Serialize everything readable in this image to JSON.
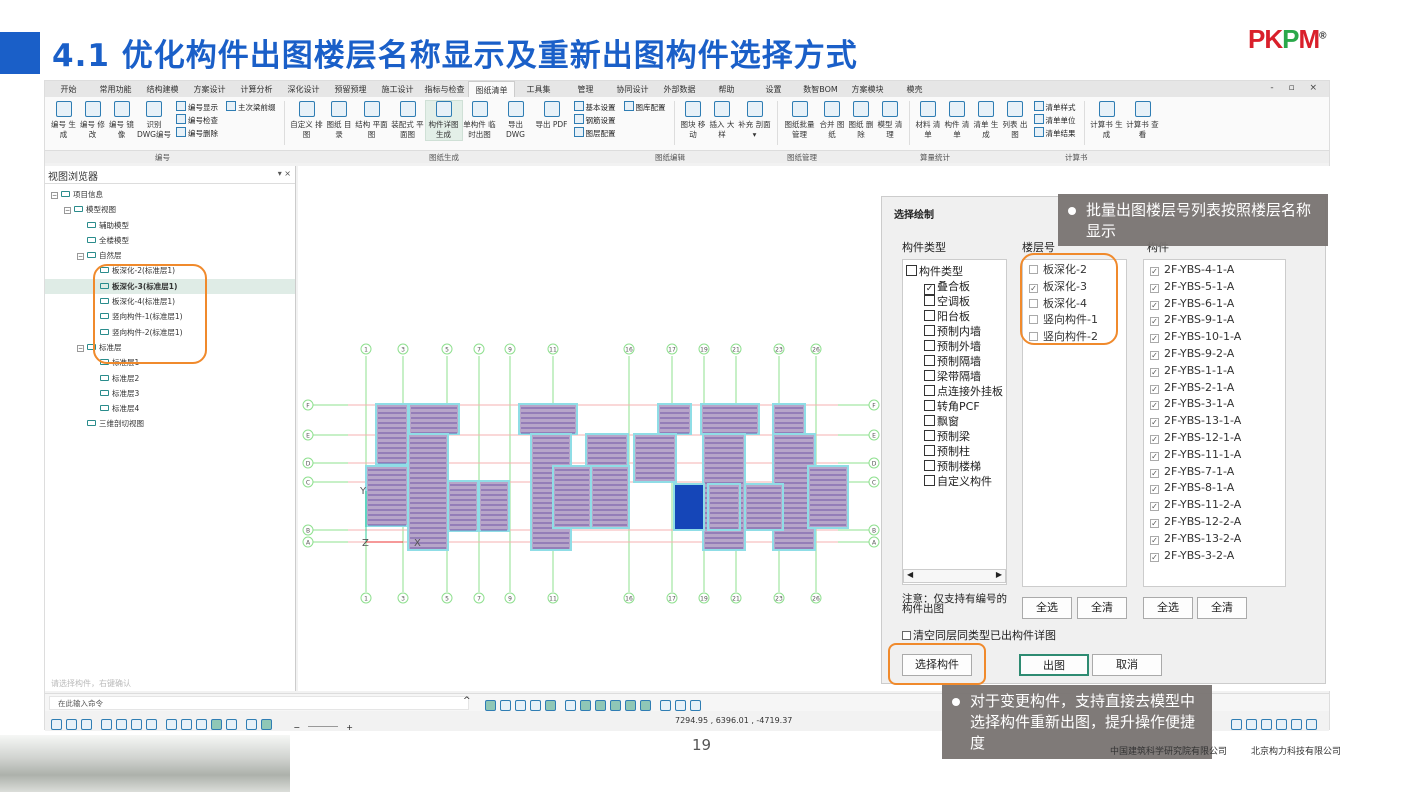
{
  "slide": {
    "title": "4.1 优化构件出图楼层名称显示及重新出图构件选择方式",
    "logo": "PKPM",
    "page_number": "19",
    "companies": [
      "中国建筑科学研究院有限公司",
      "北京构力科技有限公司"
    ]
  },
  "app": {
    "tabs": [
      "开始",
      "常用功能",
      "结构建模",
      "方案设计",
      "计算分析",
      "深化设计",
      "预留预埋",
      "施工设计",
      "指标与检查",
      "图纸清单",
      "工具集",
      "管理",
      "协同设计",
      "外部数据",
      "帮助",
      "设置",
      "数智BOM",
      "方案模块",
      "模壳"
    ],
    "active_tab": "图纸清单",
    "window_controls": "- ▫ ×",
    "ribbon": {
      "numbering": [
        "编号 生成",
        "编号 修改",
        "编号 镜像",
        "识别 DWG编号"
      ],
      "numbering_small": [
        "编号显示",
        "编号检查",
        "编号删除"
      ],
      "beam_prefix": "主次梁前缀",
      "drawing_gen": [
        "自定义 排图",
        "图纸 目录",
        "结构 平面图",
        "装配式 平面图",
        "构件详图 生成",
        "单构件 临时出图",
        "导出 DWG",
        "导出 PDF"
      ],
      "settings_small": [
        "基本设置",
        "钢筋设置",
        "图层配置"
      ],
      "library": "图库配置",
      "edit": [
        "图块 移动",
        "插入 大样",
        "补充 剖面 ▾"
      ],
      "manage": [
        "图纸批量 管理",
        "合并 图纸",
        "图纸 删除",
        "模型 清理"
      ],
      "stats": [
        "材料 清单",
        "构件 清单",
        "清单 生成",
        "列表 出图"
      ],
      "stats_small": [
        "清单样式",
        "清单单位",
        "清单结果"
      ],
      "calc": [
        "计算书 生成",
        "计算书 查看"
      ],
      "groups": [
        "编号",
        "图纸生成",
        "图纸编辑",
        "图纸管理",
        "算量统计",
        "计算书"
      ]
    },
    "browser": {
      "title": "视图浏览器",
      "controls": "▾  ×",
      "tree": [
        {
          "label": "项目信息",
          "level": 0,
          "pm": "−"
        },
        {
          "label": "模型视图",
          "level": 1,
          "pm": "−"
        },
        {
          "label": "辅助模型",
          "level": 2
        },
        {
          "label": "全楼模型",
          "level": 2
        },
        {
          "label": "自然层",
          "level": 2,
          "pm": "−"
        },
        {
          "label": "板深化-2(标准层1)",
          "level": 3
        },
        {
          "label": "板深化-3(标准层1)",
          "level": 3,
          "selected": true
        },
        {
          "label": "板深化-4(标准层1)",
          "level": 3
        },
        {
          "label": "竖向构件-1(标准层1)",
          "level": 3
        },
        {
          "label": "竖向构件-2(标准层1)",
          "level": 3
        },
        {
          "label": "标准层",
          "level": 2,
          "pm": "−"
        },
        {
          "label": "标准层1",
          "level": 3
        },
        {
          "label": "标准层2",
          "level": 3
        },
        {
          "label": "标准层3",
          "level": 3
        },
        {
          "label": "标准层4",
          "level": 3
        },
        {
          "label": "三维剖切视图",
          "level": 2
        }
      ],
      "hint": "请选择构件，右键确认"
    },
    "drawing": {
      "col_axes": [
        "1",
        "3",
        "5",
        "7",
        "9",
        "11",
        "16",
        "17",
        "19",
        "21",
        "23",
        "26"
      ],
      "row_axes": [
        "F",
        "E",
        "D",
        "C",
        "B",
        "A"
      ],
      "ucs": {
        "y": "Y",
        "z": "Z",
        "x": "X"
      }
    },
    "dialog": {
      "title": "选择绘制",
      "type_header": "构件类型",
      "floor_header": "楼层号",
      "component_header": "构件",
      "types": [
        {
          "label": "构件类型",
          "checked": false,
          "root": true
        },
        {
          "label": "叠合板",
          "checked": true
        },
        {
          "label": "空调板",
          "checked": false
        },
        {
          "label": "阳台板",
          "checked": false
        },
        {
          "label": "预制内墙",
          "checked": false
        },
        {
          "label": "预制外墙",
          "checked": false
        },
        {
          "label": "预制隔墙",
          "checked": false
        },
        {
          "label": "梁带隔墙",
          "checked": false
        },
        {
          "label": "点连接外挂板",
          "checked": false
        },
        {
          "label": "转角PCF",
          "checked": false
        },
        {
          "label": "飘窗",
          "checked": false
        },
        {
          "label": "预制梁",
          "checked": false
        },
        {
          "label": "预制柱",
          "checked": false
        },
        {
          "label": "预制楼梯",
          "checked": false
        },
        {
          "label": "自定义构件",
          "checked": false
        }
      ],
      "floors": [
        {
          "label": "板深化-2",
          "checked": false
        },
        {
          "label": "板深化-3",
          "checked": true
        },
        {
          "label": "板深化-4",
          "checked": false
        },
        {
          "label": "竖向构件-1",
          "checked": false
        },
        {
          "label": "竖向构件-2",
          "checked": false
        }
      ],
      "components": [
        "2F-YBS-4-1-A",
        "2F-YBS-5-1-A",
        "2F-YBS-6-1-A",
        "2F-YBS-9-1-A",
        "2F-YBS-10-1-A",
        "2F-YBS-9-2-A",
        "2F-YBS-1-1-A",
        "2F-YBS-2-1-A",
        "2F-YBS-3-1-A",
        "2F-YBS-13-1-A",
        "2F-YBS-12-1-A",
        "2F-YBS-11-1-A",
        "2F-YBS-7-1-A",
        "2F-YBS-8-1-A",
        "2F-YBS-11-2-A",
        "2F-YBS-12-2-A",
        "2F-YBS-13-2-A",
        "2F-YBS-3-2-A"
      ],
      "note": "注意：仅支持有编号的构件出图",
      "select_all": "全选",
      "clear_all": "全清",
      "clear_existing": "清空同层同类型已出构件详图",
      "select_component_btn": "选择构件",
      "output_btn": "出图",
      "cancel_btn": "取消"
    },
    "command": {
      "placeholder": "在此输入命令",
      "collapse": "^"
    },
    "status": {
      "coords": "7294.95 , 6396.01 , -4719.37",
      "zoom_minus": "−",
      "zoom_plus": "+"
    }
  },
  "callouts": {
    "floor_names": "批量出图楼层号列表按照楼层名称显示",
    "reselect": "对于变更构件，支持直接去模型中选择构件重新出图，提升操作便捷度"
  },
  "colors": {
    "title_blue": "#1a5fc8",
    "highlight_orange": "#f08a2c",
    "callout_gray": "#78736f",
    "accent_green": "#2e8b72"
  }
}
